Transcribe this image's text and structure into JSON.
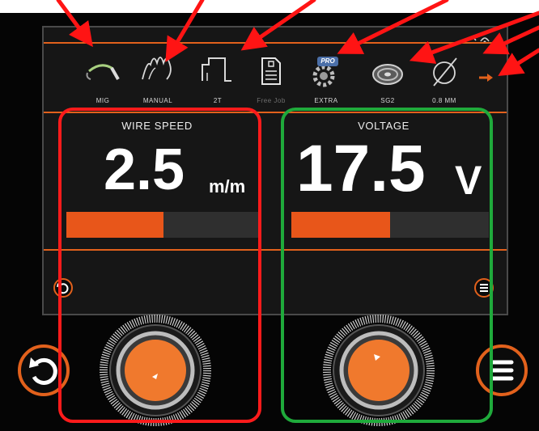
{
  "toolbar": {
    "modes": [
      {
        "label": "MIG",
        "icon": "mig-torch-icon",
        "dim": false
      },
      {
        "label": "MANUAL",
        "icon": "manual-hand-icon",
        "dim": false
      },
      {
        "label": "2T",
        "icon": "2t-trigger-icon",
        "dim": false
      },
      {
        "label": "Free Job",
        "icon": "free-job-document-icon",
        "dim": true
      },
      {
        "label": "EXTRA",
        "icon": "pro-extra-gear-icon",
        "dim": false,
        "badge": "PRO"
      },
      {
        "label": "SG2",
        "icon": "wire-spool-icon",
        "dim": false
      },
      {
        "label": "0.8 MM",
        "icon": "diameter-icon",
        "dim": false
      }
    ]
  },
  "wire_speed": {
    "title": "WIRE SPEED",
    "value": "2.5",
    "unit": "m/m",
    "level_fraction": 0.5
  },
  "voltage": {
    "title": "VOLTAGE",
    "value": "17.5",
    "unit": "V",
    "level_fraction": 0.5
  },
  "colors": {
    "accent": "#e2611c",
    "bar_fill": "#e8561a",
    "callout_red": "#ff1b1b",
    "callout_green": "#1faa3b"
  }
}
